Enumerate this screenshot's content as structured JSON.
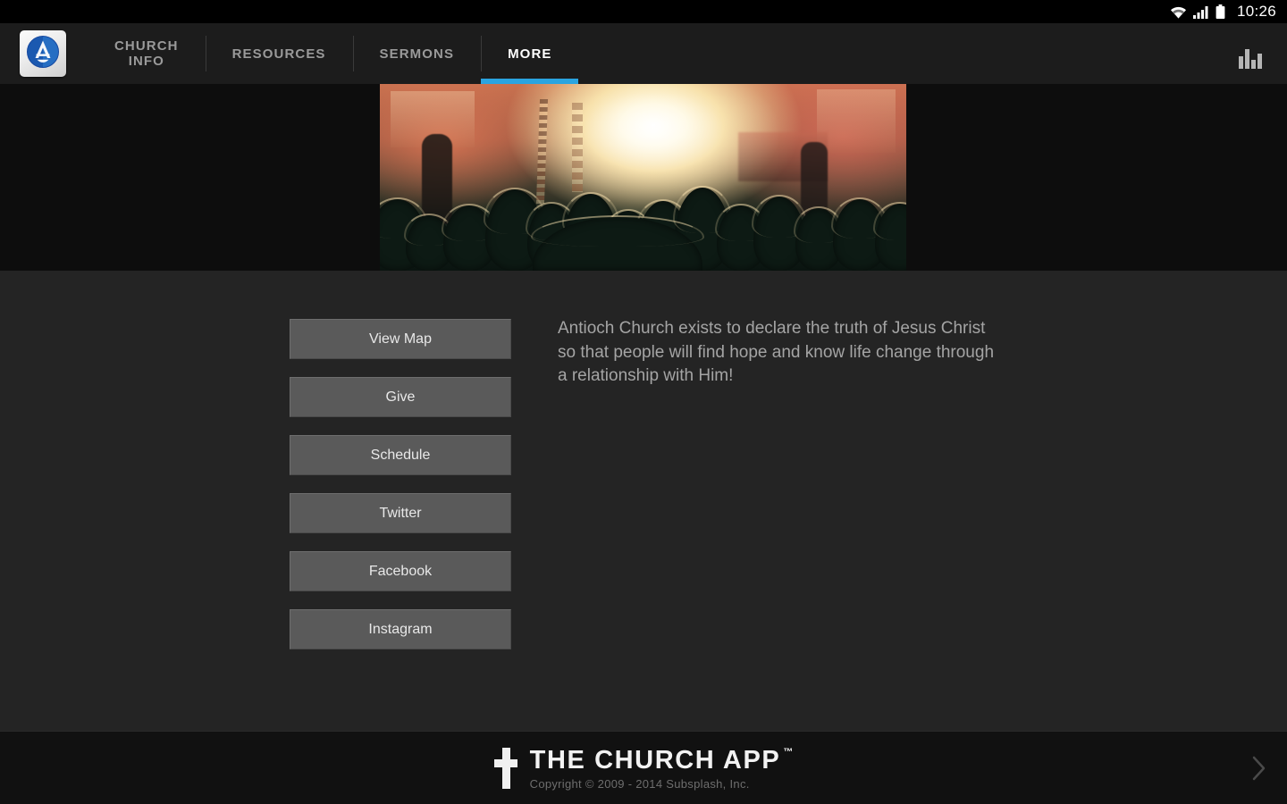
{
  "statusbar": {
    "clock": "10:26",
    "wifi_icon": "wifi-icon",
    "signal_icon": "signal-icon",
    "battery_icon": "battery-icon"
  },
  "navbar": {
    "logo_icon": "antioch-church-logo-icon",
    "chart_icon": "bar-chart-icon",
    "tabs": [
      {
        "label": "CHURCH\nINFO",
        "name": "tab-church-info",
        "active": false
      },
      {
        "label": "RESOURCES",
        "name": "tab-resources",
        "active": false
      },
      {
        "label": "SERMONS",
        "name": "tab-sermons",
        "active": false
      },
      {
        "label": "MORE",
        "name": "tab-more",
        "active": true
      }
    ],
    "accent_color": "#2aa4e0"
  },
  "hero": {
    "alt": "worship-concert-crowd-stage-lights"
  },
  "main": {
    "buttons": [
      {
        "label": "View Map",
        "name": "view-map-button"
      },
      {
        "label": "Give",
        "name": "give-button"
      },
      {
        "label": "Schedule",
        "name": "schedule-button"
      },
      {
        "label": "Twitter",
        "name": "twitter-button"
      },
      {
        "label": "Facebook",
        "name": "facebook-button"
      },
      {
        "label": "Instagram",
        "name": "instagram-button"
      }
    ],
    "description": "Antioch Church exists to declare the truth of Jesus Christ so that people will find hope and know life change through a relationship with Him!"
  },
  "footer": {
    "cross_icon": "cross-icon",
    "brand_title": "THE CHURCH APP",
    "brand_tm": "™",
    "copyright": "Copyright © 2009 - 2014 Subsplash, Inc.",
    "next_icon": "chevron-right-icon"
  },
  "colors": {
    "accent": "#2aa4e0",
    "navbar_bg": "#1c1c1c",
    "content_bg": "#242424",
    "footer_bg": "#111111",
    "button_bg": "#5a5a5a"
  }
}
